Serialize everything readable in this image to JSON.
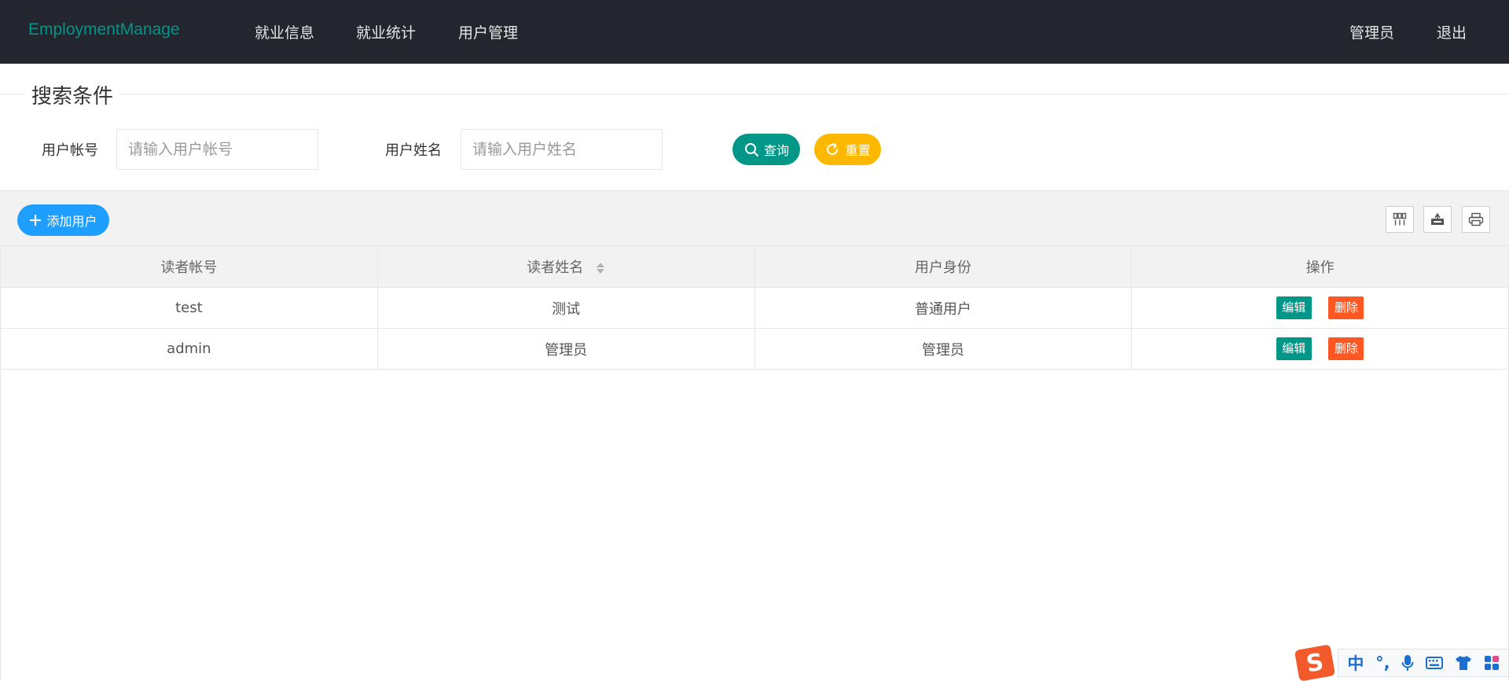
{
  "header": {
    "brand": "EmploymentManage",
    "nav": [
      "就业信息",
      "就业统计",
      "用户管理"
    ],
    "admin_label": "管理员",
    "logout_label": "退出"
  },
  "search": {
    "legend": "搜索条件",
    "account_label": "用户帐号",
    "account_placeholder": "请输入用户帐号",
    "name_label": "用户姓名",
    "name_placeholder": "请输入用户姓名",
    "query_label": "查询",
    "reset_label": "重置"
  },
  "toolbar": {
    "add_label": "添加用户"
  },
  "table": {
    "columns": [
      "读者帐号",
      "读者姓名",
      "用户身份",
      "操作"
    ],
    "rows": [
      {
        "account": "test",
        "name": "测试",
        "role": "普通用户"
      },
      {
        "account": "admin",
        "name": "管理员",
        "role": "管理员"
      }
    ],
    "edit_label": "编辑",
    "delete_label": "删除"
  },
  "ime": {
    "logo": "S",
    "mode": "中",
    "punct": "°,"
  },
  "colors": {
    "header_bg": "#23262e",
    "brand": "#009688",
    "query": "#009688",
    "reset": "#ffb800",
    "add": "#1e9fff",
    "delete": "#ff5722"
  }
}
